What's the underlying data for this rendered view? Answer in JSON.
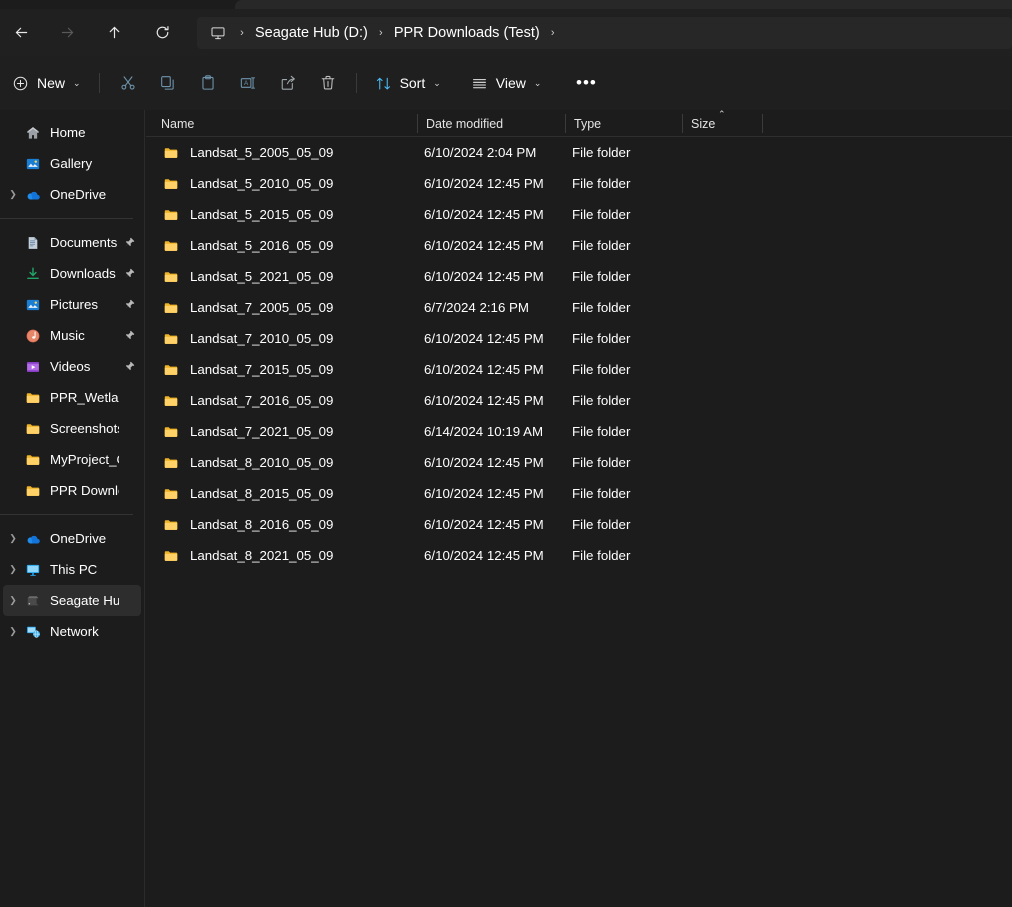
{
  "window": {
    "theme_bg": "#1c1c1c",
    "accent": "#4cc2ff",
    "folder_color": "#f2c14b"
  },
  "navigation": {
    "back": "Back",
    "forward": "Forward",
    "up": "Up",
    "refresh": "Refresh"
  },
  "breadcrumb": {
    "root_icon": "this-pc-icon",
    "separator": "›",
    "items": [
      {
        "label": "Seagate Hub (D:)"
      },
      {
        "label": "PPR Downloads (Test)"
      }
    ]
  },
  "toolbar": {
    "new_label": "New",
    "new_chevron": "⌄",
    "cut_label": "Cut",
    "copy_label": "Copy",
    "paste_label": "Paste",
    "rename_label": "Rename",
    "share_label": "Share",
    "delete_label": "Delete",
    "sort_label": "Sort",
    "sort_chevron": "⌄",
    "view_label": "View",
    "view_chevron": "⌄",
    "more_label": "•••"
  },
  "sidebar": {
    "groups": [
      {
        "items": [
          {
            "label": "Home",
            "icon": "home-icon",
            "chevron": false,
            "pinned": false,
            "selected": false
          },
          {
            "label": "Gallery",
            "icon": "gallery-icon",
            "chevron": false,
            "pinned": false,
            "selected": false
          },
          {
            "label": "OneDrive",
            "icon": "onedrive-icon",
            "chevron": true,
            "pinned": false,
            "selected": false
          }
        ]
      },
      {
        "items": [
          {
            "label": "Documents",
            "icon": "documents-icon",
            "chevron": false,
            "pinned": true,
            "selected": false
          },
          {
            "label": "Downloads",
            "icon": "downloads-icon",
            "chevron": false,
            "pinned": true,
            "selected": false
          },
          {
            "label": "Pictures",
            "icon": "pictures-icon",
            "chevron": false,
            "pinned": true,
            "selected": false
          },
          {
            "label": "Music",
            "icon": "music-icon",
            "chevron": false,
            "pinned": true,
            "selected": false
          },
          {
            "label": "Videos",
            "icon": "videos-icon",
            "chevron": false,
            "pinned": true,
            "selected": false
          },
          {
            "label": "PPR_Wetlands",
            "icon": "folder-icon",
            "chevron": false,
            "pinned": false,
            "selected": false
          },
          {
            "label": "Screenshots",
            "icon": "folder-icon",
            "chevron": false,
            "pinned": false,
            "selected": false
          },
          {
            "label": "MyProject_GEE",
            "icon": "folder-icon",
            "chevron": false,
            "pinned": false,
            "selected": false
          },
          {
            "label": "PPR Downloads (Te",
            "icon": "folder-icon",
            "chevron": false,
            "pinned": false,
            "selected": false
          }
        ]
      },
      {
        "items": [
          {
            "label": "OneDrive",
            "icon": "onedrive-icon",
            "chevron": true,
            "pinned": false,
            "selected": false
          },
          {
            "label": "This PC",
            "icon": "this-pc-icon",
            "chevron": true,
            "pinned": false,
            "selected": false
          },
          {
            "label": "Seagate Hub (D:)",
            "icon": "drive-icon",
            "chevron": true,
            "pinned": false,
            "selected": true
          },
          {
            "label": "Network",
            "icon": "network-icon",
            "chevron": true,
            "pinned": false,
            "selected": false
          }
        ]
      }
    ]
  },
  "filelist": {
    "columns": [
      {
        "label": "Name",
        "sorted": false
      },
      {
        "label": "Date modified",
        "sorted": false
      },
      {
        "label": "Type",
        "sorted": false
      },
      {
        "label": "Size",
        "sorted": true,
        "sort_direction": "ascending",
        "sort_glyph": "⌃"
      }
    ],
    "rows": [
      {
        "name": "Landsat_5_2005_05_09",
        "date": "6/10/2024 2:04 PM",
        "type": "File folder",
        "size": ""
      },
      {
        "name": "Landsat_5_2010_05_09",
        "date": "6/10/2024 12:45 PM",
        "type": "File folder",
        "size": ""
      },
      {
        "name": "Landsat_5_2015_05_09",
        "date": "6/10/2024 12:45 PM",
        "type": "File folder",
        "size": ""
      },
      {
        "name": "Landsat_5_2016_05_09",
        "date": "6/10/2024 12:45 PM",
        "type": "File folder",
        "size": ""
      },
      {
        "name": "Landsat_5_2021_05_09",
        "date": "6/10/2024 12:45 PM",
        "type": "File folder",
        "size": ""
      },
      {
        "name": "Landsat_7_2005_05_09",
        "date": "6/7/2024 2:16 PM",
        "type": "File folder",
        "size": ""
      },
      {
        "name": "Landsat_7_2010_05_09",
        "date": "6/10/2024 12:45 PM",
        "type": "File folder",
        "size": ""
      },
      {
        "name": "Landsat_7_2015_05_09",
        "date": "6/10/2024 12:45 PM",
        "type": "File folder",
        "size": ""
      },
      {
        "name": "Landsat_7_2016_05_09",
        "date": "6/10/2024 12:45 PM",
        "type": "File folder",
        "size": ""
      },
      {
        "name": "Landsat_7_2021_05_09",
        "date": "6/14/2024 10:19 AM",
        "type": "File folder",
        "size": ""
      },
      {
        "name": "Landsat_8_2010_05_09",
        "date": "6/10/2024 12:45 PM",
        "type": "File folder",
        "size": ""
      },
      {
        "name": "Landsat_8_2015_05_09",
        "date": "6/10/2024 12:45 PM",
        "type": "File folder",
        "size": ""
      },
      {
        "name": "Landsat_8_2016_05_09",
        "date": "6/10/2024 12:45 PM",
        "type": "File folder",
        "size": ""
      },
      {
        "name": "Landsat_8_2021_05_09",
        "date": "6/10/2024 12:45 PM",
        "type": "File folder",
        "size": ""
      }
    ]
  }
}
